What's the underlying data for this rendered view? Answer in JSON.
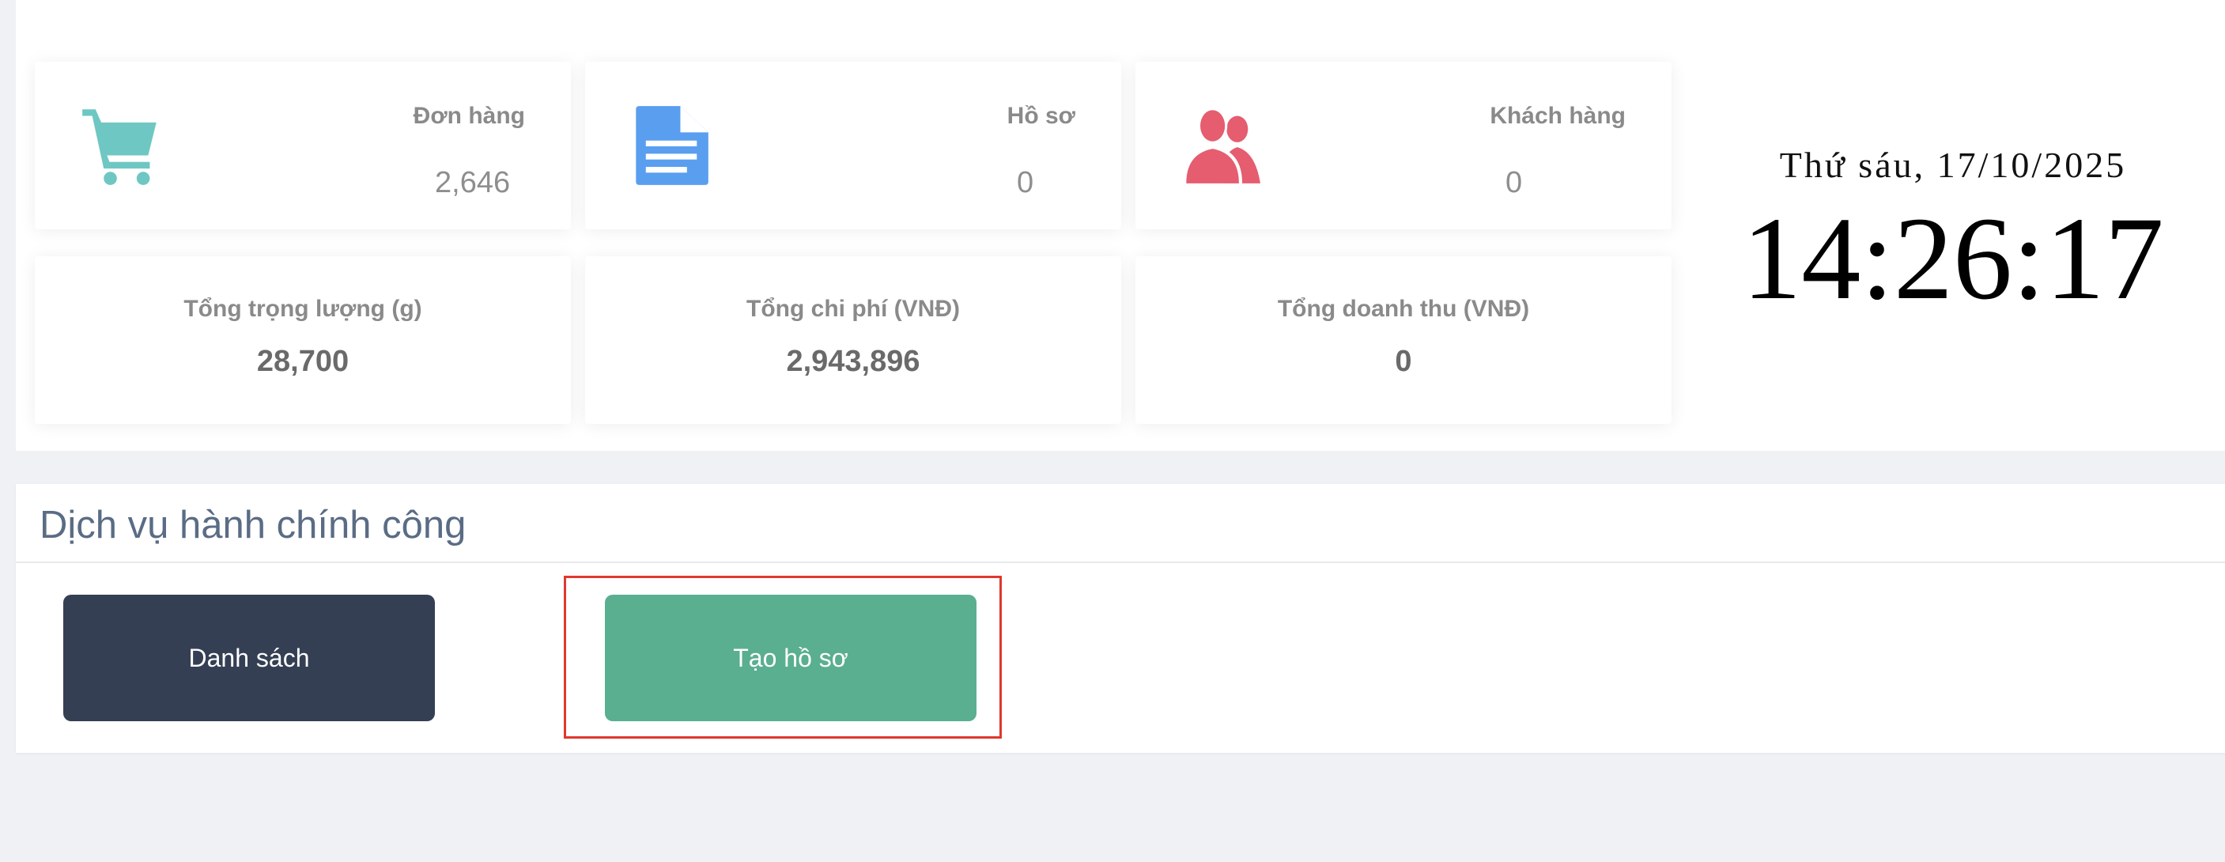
{
  "stats": {
    "orders": {
      "label": "Đơn hàng",
      "value": "2,646",
      "icon": "shopping-cart-icon",
      "color": "#6ec7c3"
    },
    "records": {
      "label": "Hồ sơ",
      "value": "0",
      "icon": "document-icon",
      "color": "#5a9ef0"
    },
    "customers": {
      "label": "Khách hàng",
      "value": "0",
      "icon": "users-icon",
      "color": "#e55d6f"
    },
    "total_weight": {
      "label": "Tổng trọng lượng (g)",
      "value": "28,700"
    },
    "total_cost": {
      "label": "Tổng chi phí (VNĐ)",
      "value": "2,943,896"
    },
    "total_revenue": {
      "label": "Tổng doanh thu (VNĐ)",
      "value": "0"
    }
  },
  "clock": {
    "date": "Thứ sáu, 17/10/2025",
    "time": "14:26:17"
  },
  "services": {
    "title": "Dịch vụ hành chính công",
    "list_button": {
      "label": "Danh sách",
      "color": "#353f54"
    },
    "create_button": {
      "label": "Tạo hồ sơ",
      "color": "#5aaf90"
    }
  },
  "highlight_color": "#e0382e"
}
